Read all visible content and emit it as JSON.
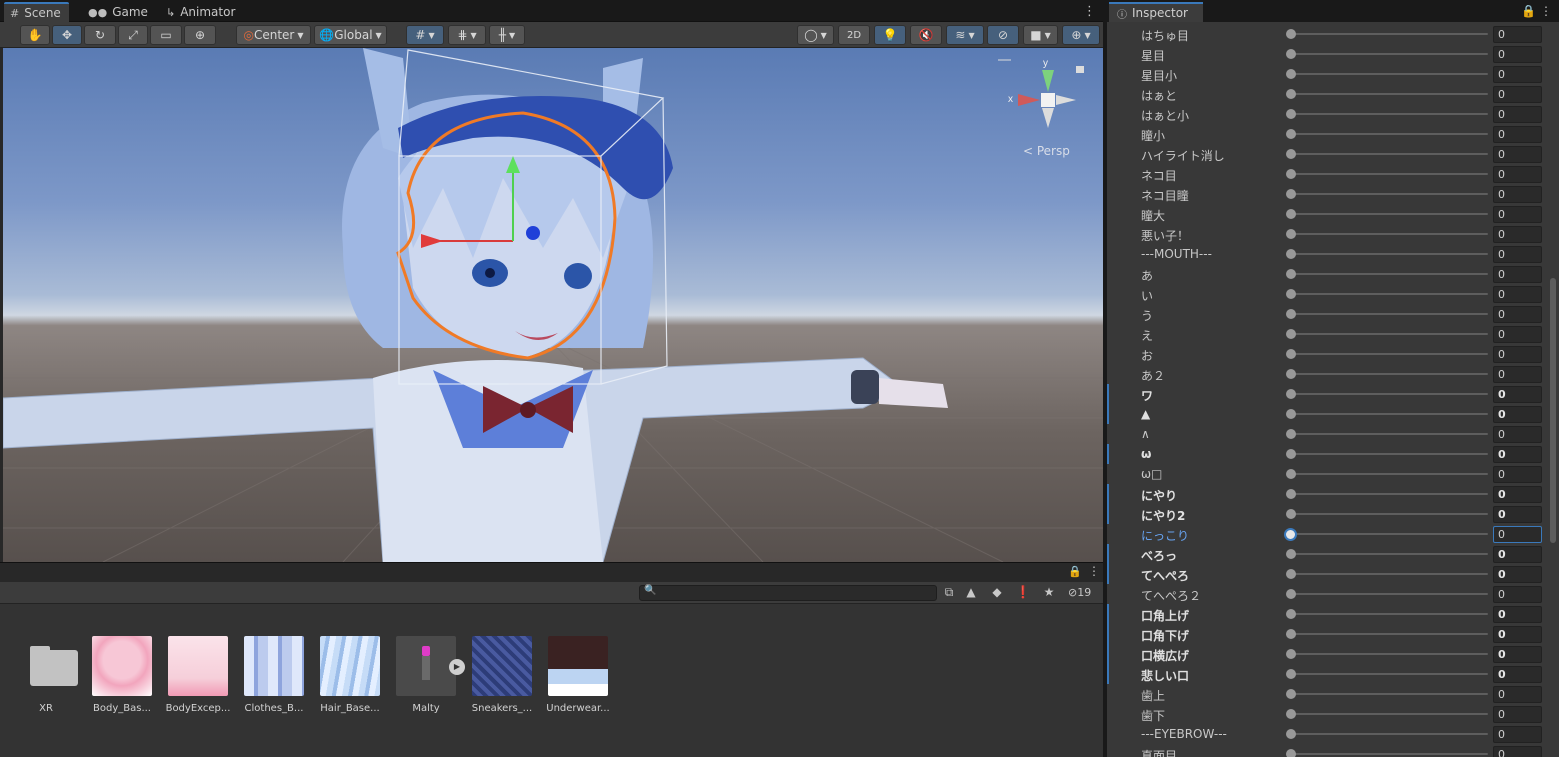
{
  "tabs": {
    "scene": "Scene",
    "game": "Game",
    "animator": "Animator"
  },
  "toolbar": {
    "pivot": "Center",
    "space": "Global",
    "mode_2d": "2D",
    "tools": [
      "hand-tool",
      "move-tool",
      "rotate-tool",
      "scale-tool",
      "rect-tool",
      "transform-tool"
    ]
  },
  "scene": {
    "projection_label": "< Persp",
    "axis_x": "x",
    "axis_y": "y"
  },
  "project": {
    "hidden_count": "19",
    "search_value": "",
    "assets": [
      {
        "name": "XR",
        "type": "folder"
      },
      {
        "name": "Body_Bas...",
        "type": "texture"
      },
      {
        "name": "BodyExcep...",
        "type": "texture"
      },
      {
        "name": "Clothes_B...",
        "type": "texture"
      },
      {
        "name": "Hair_Base...",
        "type": "texture"
      },
      {
        "name": "Malty",
        "type": "prefab"
      },
      {
        "name": "Sneakers_...",
        "type": "texture"
      },
      {
        "name": "Underwear...",
        "type": "texture"
      }
    ]
  },
  "inspector": {
    "title": "Inspector",
    "blendshapes": [
      {
        "label": "はちゅ目",
        "value": "0",
        "modified": false
      },
      {
        "label": "星目",
        "value": "0",
        "modified": false
      },
      {
        "label": "星目小",
        "value": "0",
        "modified": false
      },
      {
        "label": "はぁと",
        "value": "0",
        "modified": false
      },
      {
        "label": "はぁと小",
        "value": "0",
        "modified": false
      },
      {
        "label": "瞳小",
        "value": "0",
        "modified": false
      },
      {
        "label": "ハイライト消し",
        "value": "0",
        "modified": false
      },
      {
        "label": "ネコ目",
        "value": "0",
        "modified": false
      },
      {
        "label": "ネコ目瞳",
        "value": "0",
        "modified": false
      },
      {
        "label": "瞳大",
        "value": "0",
        "modified": false
      },
      {
        "label": "悪い子！",
        "value": "0",
        "modified": false
      },
      {
        "label": "---MOUTH---",
        "value": "0",
        "modified": false
      },
      {
        "label": "あ",
        "value": "0",
        "modified": false
      },
      {
        "label": "い",
        "value": "0",
        "modified": false
      },
      {
        "label": "う",
        "value": "0",
        "modified": false
      },
      {
        "label": "え",
        "value": "0",
        "modified": false
      },
      {
        "label": "お",
        "value": "0",
        "modified": false
      },
      {
        "label": "あ２",
        "value": "0",
        "modified": false
      },
      {
        "label": "ワ",
        "value": "0",
        "modified": true
      },
      {
        "label": "▲",
        "value": "0",
        "modified": true
      },
      {
        "label": "∧",
        "value": "0",
        "modified": false
      },
      {
        "label": "ω",
        "value": "0",
        "modified": true
      },
      {
        "label": "ω□",
        "value": "0",
        "modified": false
      },
      {
        "label": "にやり",
        "value": "0",
        "modified": true
      },
      {
        "label": "にやり2",
        "value": "0",
        "modified": true
      },
      {
        "label": "にっこり",
        "value": "0",
        "modified": false,
        "active": true
      },
      {
        "label": "べろっ",
        "value": "0",
        "modified": true
      },
      {
        "label": "てへぺろ",
        "value": "0",
        "modified": true
      },
      {
        "label": "てへぺろ２",
        "value": "0",
        "modified": false
      },
      {
        "label": "口角上げ",
        "value": "0",
        "modified": true
      },
      {
        "label": "口角下げ",
        "value": "0",
        "modified": true
      },
      {
        "label": "口横広げ",
        "value": "0",
        "modified": true
      },
      {
        "label": "悲しい口",
        "value": "0",
        "modified": true
      },
      {
        "label": "歯上",
        "value": "0",
        "modified": false
      },
      {
        "label": "歯下",
        "value": "0",
        "modified": false
      },
      {
        "label": "---EYEBROW---",
        "value": "0",
        "modified": false
      },
      {
        "label": "真面目",
        "value": "0",
        "modified": false
      }
    ]
  },
  "colors": {
    "accent": "#3a79bb",
    "panel": "#383838",
    "background": "#282828"
  }
}
